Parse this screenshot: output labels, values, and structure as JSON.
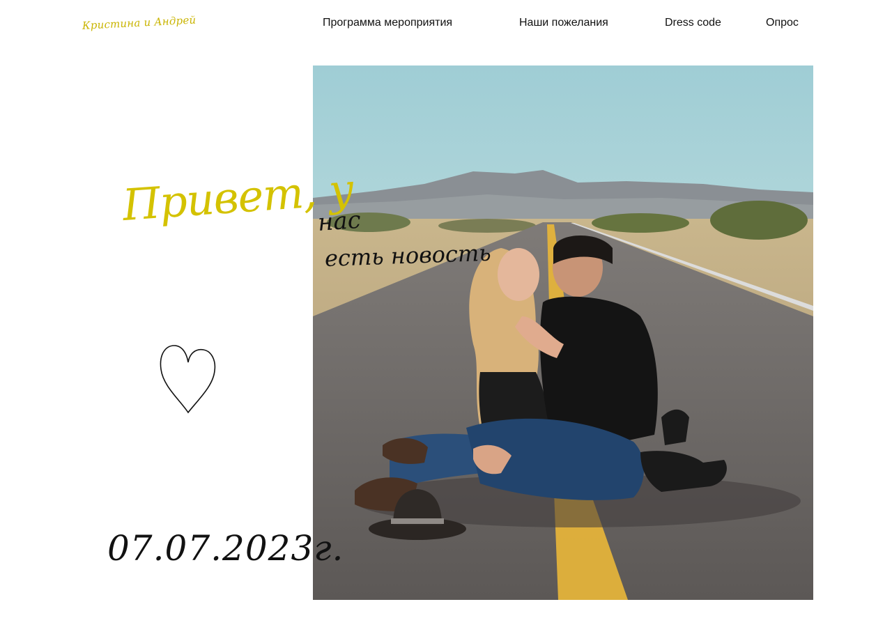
{
  "brand": {
    "logo_text": "Кристина и Андрей",
    "accent_color": "#d4c200"
  },
  "nav": {
    "items": [
      {
        "label": "Программа мероприятия"
      },
      {
        "label": "Наши пожелания"
      },
      {
        "label": "Dress code"
      },
      {
        "label": "Опрос"
      }
    ]
  },
  "hero": {
    "headline_part1": "Привет, у",
    "headline_part2": "нас",
    "headline_part3": "есть новость",
    "heart_icon": "heart-outline-icon",
    "date": "07.07.2023г.",
    "photo_description_icon": "couple-on-road-photo"
  }
}
